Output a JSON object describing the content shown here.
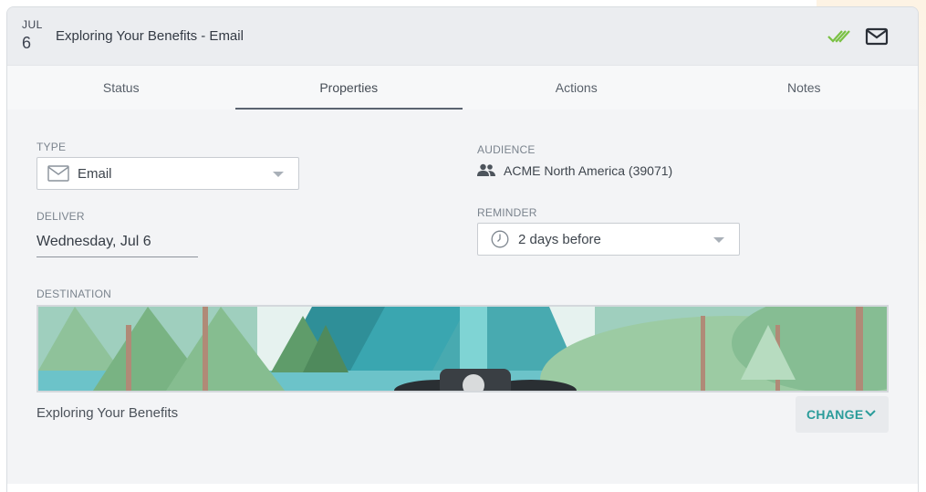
{
  "header": {
    "month": "JUL",
    "day": "6",
    "title": "Exploring Your Benefits - Email",
    "status_icon": "double-check-icon",
    "type_icon": "mail-icon",
    "accent": "#7ac143"
  },
  "tabs": [
    {
      "label": "Status",
      "active": false
    },
    {
      "label": "Properties",
      "active": true
    },
    {
      "label": "Actions",
      "active": false
    },
    {
      "label": "Notes",
      "active": false
    }
  ],
  "properties": {
    "type": {
      "label": "TYPE",
      "value": "Email",
      "icon": "envelope-icon"
    },
    "audience": {
      "label": "AUDIENCE",
      "value": "ACME North America (39071)",
      "icon": "people-icon"
    },
    "deliver": {
      "label": "DELIVER",
      "value": "Wednesday, Jul 6"
    },
    "reminder": {
      "label": "REMINDER",
      "value": "2 days before",
      "icon": "clock-icon"
    },
    "destination": {
      "label": "DESTINATION",
      "name": "Exploring Your Benefits",
      "change_label": "CHANGE",
      "change_color": "#2a9c9a"
    }
  }
}
